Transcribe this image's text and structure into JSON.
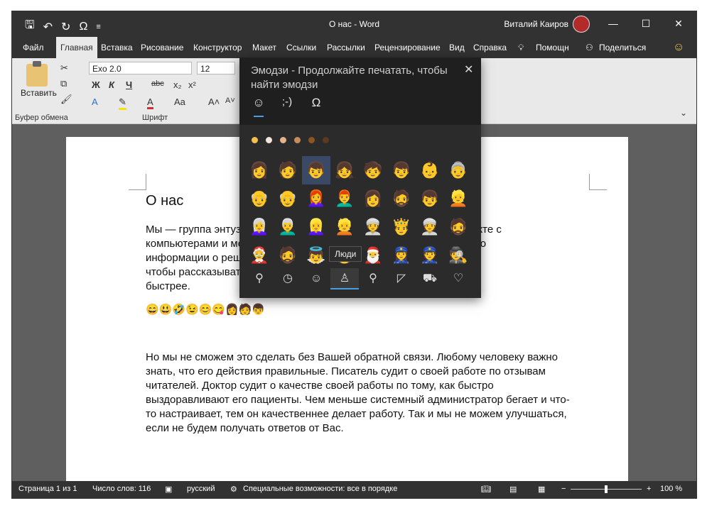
{
  "window": {
    "title": "О нас  -  Word",
    "user_name": "Виталий Каиров",
    "controls": {
      "minimize": "—",
      "maximize": "☐",
      "close": "✕"
    },
    "qat_icons": [
      "save-icon",
      "undo-icon",
      "redo-icon",
      "omega-icon",
      "customize-icon"
    ]
  },
  "tabs": [
    "Файл",
    "Главная",
    "Вставка",
    "Рисование",
    "Конструктор",
    "Макет",
    "Ссылки",
    "Рассылки",
    "Рецензирование",
    "Вид",
    "Справка"
  ],
  "tab_help_search": "Помощн",
  "share": "Поделиться",
  "ribbon": {
    "paste": "Вставить",
    "clipboard_group": "Буфер обмена",
    "font_group": "Шрифт",
    "font_name": "Exo 2.0",
    "font_size": "12",
    "format_buttons": [
      "Ж",
      "К",
      "Ч",
      "abc",
      "x₂",
      "x²"
    ],
    "font_color_letter": "A",
    "change_case": "Aa"
  },
  "document": {
    "heading": "О нас",
    "para1_lines": [
      "Мы — группа энтузиастов, которые находятся в ежедневном контакте с",
      "компьютерами и мобильными устройствами. В интернете уже полно",
      "информации о решениях проблем, но это не останавливает нас,",
      "чтобы рассказывать вам, как решать их более качественно и",
      "быстрее."
    ],
    "emoji_line": "😄😃🤣😉😊😋👩🧑👦",
    "para2_lines": [
      "Но мы не сможем это сделать без Вашей обратной связи. Любому человеку важно",
      "знать, что его действия правильные. Писатель судит о своей работе по отзывам",
      "читателей. Доктор судит о качестве своей работы по тому, как быстро",
      "выздоравливают его пациенты. Чем меньше системный администратор бегает и что-",
      "то настраивает, тем он качественнее делает работу. Так и мы не можем улучшаться,",
      "если не будем получать ответов от Вас."
    ]
  },
  "emoji_panel": {
    "title": "Эмодзи - Продолжайте печатать, чтобы найти эмодзи",
    "close": "✕",
    "tabs": [
      "☺",
      ";-)",
      "Ω"
    ],
    "tones": [
      "#f2c14e",
      "#f5e6da",
      "#e2b48e",
      "#c58c5c",
      "#8d5524",
      "#5c3a21"
    ],
    "grid": [
      [
        "👩",
        "🧑",
        "👦",
        "👧",
        "🧒",
        "👦",
        "👶",
        "👵"
      ],
      [
        "👴",
        "👴",
        "👩‍🦰",
        "👨‍🦰",
        "👩",
        "🧔",
        "👦",
        "👱"
      ],
      [
        "👩‍🦳",
        "👨‍🦳",
        "👱‍♀️",
        "👱",
        "👳‍♀️",
        "🤴",
        "👳",
        "🧔"
      ],
      [
        "🤶",
        "🧔",
        "👼",
        "🧑",
        "🎅",
        "👮‍♀️",
        "👮",
        "🕵️"
      ]
    ],
    "tooltip": "Люди",
    "categories": [
      "search-icon",
      "clock-icon",
      "smiley-icon",
      "people-icon",
      "pin-icon",
      "pizza-icon",
      "car-icon",
      "heart-icon"
    ],
    "category_glyphs": [
      "⚲",
      "◷",
      "☺",
      "♙",
      "⚲",
      "◸",
      "⛟",
      "♡"
    ],
    "active_category": "Люди"
  },
  "status": {
    "page": "Страница 1 из 1",
    "words": "Число слов: 116",
    "language": "русский",
    "accessibility": "Специальные возможности: все в порядке",
    "zoom": "100 %",
    "zoom_minus": "−",
    "zoom_plus": "+"
  }
}
